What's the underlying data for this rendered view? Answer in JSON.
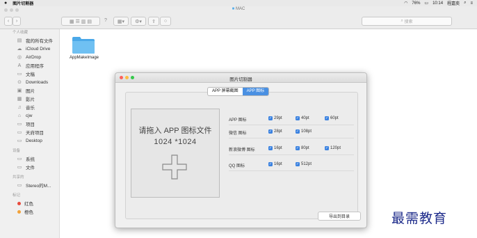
{
  "menubar": {
    "apple": "",
    "app_name": "图片切割器",
    "clock": "10:14",
    "user": "程嘉奕",
    "battery": "76%"
  },
  "finder": {
    "title": "MAC",
    "search_placeholder": "搜索",
    "sidebar": {
      "favorites_header": "个人收藏",
      "favorites": [
        {
          "label": "我的所有文件",
          "icon": "all-files-icon"
        },
        {
          "label": "iCloud Drive",
          "icon": "cloud-icon"
        },
        {
          "label": "AirDrop",
          "icon": "airdrop-icon"
        },
        {
          "label": "应用程序",
          "icon": "applications-icon"
        },
        {
          "label": "文稿",
          "icon": "documents-icon"
        },
        {
          "label": "Downloads",
          "icon": "downloads-icon"
        },
        {
          "label": "图片",
          "icon": "pictures-icon"
        },
        {
          "label": "影片",
          "icon": "movies-icon"
        },
        {
          "label": "音乐",
          "icon": "music-icon"
        },
        {
          "label": "cjw",
          "icon": "home-icon"
        },
        {
          "label": "项目",
          "icon": "folder-icon"
        },
        {
          "label": "天府项目",
          "icon": "folder-icon"
        },
        {
          "label": "Desktop",
          "icon": "desktop-icon"
        }
      ],
      "devices_header": "设备",
      "devices": [
        {
          "label": "系统",
          "icon": "disk-icon"
        },
        {
          "label": "文件",
          "icon": "disk-icon"
        }
      ],
      "shared_header": "共享的",
      "shared": [
        {
          "label": "Stereo的M...",
          "icon": "computer-icon"
        }
      ],
      "tags_header": "标记",
      "tags": [
        {
          "label": "红色",
          "color": "#e84a3c"
        },
        {
          "label": "橙色",
          "color": "#f2a23a"
        }
      ]
    },
    "folder_label": "AppMakeImage"
  },
  "dialog": {
    "title": "图片切割器",
    "tabs": [
      "APP 屏幕截图",
      "APP 图标"
    ],
    "active_tab": 1,
    "drop_line1": "请拖入 APP 图标文件",
    "drop_line2": "1024 *1024",
    "rows": [
      {
        "label": "APP 图标",
        "options": [
          "29pt",
          "40pt",
          "60pt"
        ]
      },
      {
        "label": "微信 图标",
        "options": [
          "28pt",
          "108pt"
        ]
      },
      {
        "label": "新浪微博 图标",
        "options": [
          "16pt",
          "80pt",
          "120pt"
        ]
      },
      {
        "label": "QQ 图标",
        "options": [
          "16pt",
          "512pt"
        ]
      }
    ],
    "export_label": "导出到目录"
  },
  "watermark": "最需教育",
  "colors": {
    "accent": "#4a90e2",
    "checkbox": "#3b82e0",
    "folder": "#4aa8e8",
    "watermark": "#1c2a8a"
  }
}
